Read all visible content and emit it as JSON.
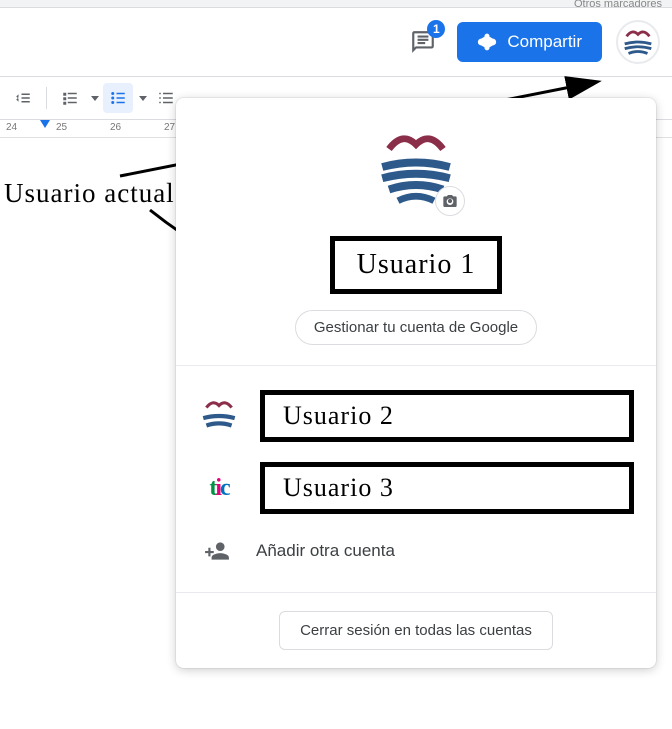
{
  "bookmarks_hint": "Otros marcadores",
  "header": {
    "comments_badge": "1",
    "share_label": "Compartir"
  },
  "ruler": {
    "ticks": [
      "24",
      "25",
      "26",
      "27"
    ]
  },
  "annotation": {
    "label": "Usuario  actual"
  },
  "popup": {
    "current_user_label": "Usuario  1",
    "manage_label": "Gestionar tu cuenta de Google",
    "other_users": [
      {
        "label": "Usuario  2",
        "avatar": "logo"
      },
      {
        "label": "Usuario  3",
        "avatar": "tic"
      }
    ],
    "add_account_label": "Añadir otra cuenta",
    "sign_out_label": "Cerrar sesión en todas las cuentas"
  },
  "colors": {
    "primary": "#1a73e8",
    "text": "#3c4043",
    "border": "#dadce0"
  }
}
